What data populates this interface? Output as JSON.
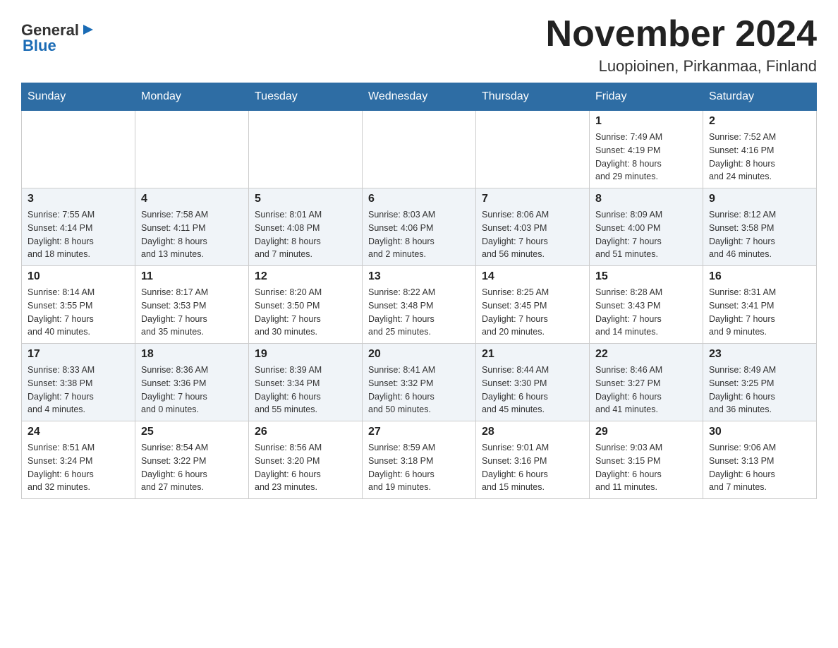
{
  "header": {
    "logo_general": "General",
    "logo_blue": "Blue",
    "title": "November 2024",
    "subtitle": "Luopioinen, Pirkanmaa, Finland"
  },
  "weekdays": [
    "Sunday",
    "Monday",
    "Tuesday",
    "Wednesday",
    "Thursday",
    "Friday",
    "Saturday"
  ],
  "weeks": [
    {
      "days": [
        {
          "number": "",
          "info": ""
        },
        {
          "number": "",
          "info": ""
        },
        {
          "number": "",
          "info": ""
        },
        {
          "number": "",
          "info": ""
        },
        {
          "number": "",
          "info": ""
        },
        {
          "number": "1",
          "info": "Sunrise: 7:49 AM\nSunset: 4:19 PM\nDaylight: 8 hours\nand 29 minutes."
        },
        {
          "number": "2",
          "info": "Sunrise: 7:52 AM\nSunset: 4:16 PM\nDaylight: 8 hours\nand 24 minutes."
        }
      ]
    },
    {
      "days": [
        {
          "number": "3",
          "info": "Sunrise: 7:55 AM\nSunset: 4:14 PM\nDaylight: 8 hours\nand 18 minutes."
        },
        {
          "number": "4",
          "info": "Sunrise: 7:58 AM\nSunset: 4:11 PM\nDaylight: 8 hours\nand 13 minutes."
        },
        {
          "number": "5",
          "info": "Sunrise: 8:01 AM\nSunset: 4:08 PM\nDaylight: 8 hours\nand 7 minutes."
        },
        {
          "number": "6",
          "info": "Sunrise: 8:03 AM\nSunset: 4:06 PM\nDaylight: 8 hours\nand 2 minutes."
        },
        {
          "number": "7",
          "info": "Sunrise: 8:06 AM\nSunset: 4:03 PM\nDaylight: 7 hours\nand 56 minutes."
        },
        {
          "number": "8",
          "info": "Sunrise: 8:09 AM\nSunset: 4:00 PM\nDaylight: 7 hours\nand 51 minutes."
        },
        {
          "number": "9",
          "info": "Sunrise: 8:12 AM\nSunset: 3:58 PM\nDaylight: 7 hours\nand 46 minutes."
        }
      ]
    },
    {
      "days": [
        {
          "number": "10",
          "info": "Sunrise: 8:14 AM\nSunset: 3:55 PM\nDaylight: 7 hours\nand 40 minutes."
        },
        {
          "number": "11",
          "info": "Sunrise: 8:17 AM\nSunset: 3:53 PM\nDaylight: 7 hours\nand 35 minutes."
        },
        {
          "number": "12",
          "info": "Sunrise: 8:20 AM\nSunset: 3:50 PM\nDaylight: 7 hours\nand 30 minutes."
        },
        {
          "number": "13",
          "info": "Sunrise: 8:22 AM\nSunset: 3:48 PM\nDaylight: 7 hours\nand 25 minutes."
        },
        {
          "number": "14",
          "info": "Sunrise: 8:25 AM\nSunset: 3:45 PM\nDaylight: 7 hours\nand 20 minutes."
        },
        {
          "number": "15",
          "info": "Sunrise: 8:28 AM\nSunset: 3:43 PM\nDaylight: 7 hours\nand 14 minutes."
        },
        {
          "number": "16",
          "info": "Sunrise: 8:31 AM\nSunset: 3:41 PM\nDaylight: 7 hours\nand 9 minutes."
        }
      ]
    },
    {
      "days": [
        {
          "number": "17",
          "info": "Sunrise: 8:33 AM\nSunset: 3:38 PM\nDaylight: 7 hours\nand 4 minutes."
        },
        {
          "number": "18",
          "info": "Sunrise: 8:36 AM\nSunset: 3:36 PM\nDaylight: 7 hours\nand 0 minutes."
        },
        {
          "number": "19",
          "info": "Sunrise: 8:39 AM\nSunset: 3:34 PM\nDaylight: 6 hours\nand 55 minutes."
        },
        {
          "number": "20",
          "info": "Sunrise: 8:41 AM\nSunset: 3:32 PM\nDaylight: 6 hours\nand 50 minutes."
        },
        {
          "number": "21",
          "info": "Sunrise: 8:44 AM\nSunset: 3:30 PM\nDaylight: 6 hours\nand 45 minutes."
        },
        {
          "number": "22",
          "info": "Sunrise: 8:46 AM\nSunset: 3:27 PM\nDaylight: 6 hours\nand 41 minutes."
        },
        {
          "number": "23",
          "info": "Sunrise: 8:49 AM\nSunset: 3:25 PM\nDaylight: 6 hours\nand 36 minutes."
        }
      ]
    },
    {
      "days": [
        {
          "number": "24",
          "info": "Sunrise: 8:51 AM\nSunset: 3:24 PM\nDaylight: 6 hours\nand 32 minutes."
        },
        {
          "number": "25",
          "info": "Sunrise: 8:54 AM\nSunset: 3:22 PM\nDaylight: 6 hours\nand 27 minutes."
        },
        {
          "number": "26",
          "info": "Sunrise: 8:56 AM\nSunset: 3:20 PM\nDaylight: 6 hours\nand 23 minutes."
        },
        {
          "number": "27",
          "info": "Sunrise: 8:59 AM\nSunset: 3:18 PM\nDaylight: 6 hours\nand 19 minutes."
        },
        {
          "number": "28",
          "info": "Sunrise: 9:01 AM\nSunset: 3:16 PM\nDaylight: 6 hours\nand 15 minutes."
        },
        {
          "number": "29",
          "info": "Sunrise: 9:03 AM\nSunset: 3:15 PM\nDaylight: 6 hours\nand 11 minutes."
        },
        {
          "number": "30",
          "info": "Sunrise: 9:06 AM\nSunset: 3:13 PM\nDaylight: 6 hours\nand 7 minutes."
        }
      ]
    }
  ]
}
